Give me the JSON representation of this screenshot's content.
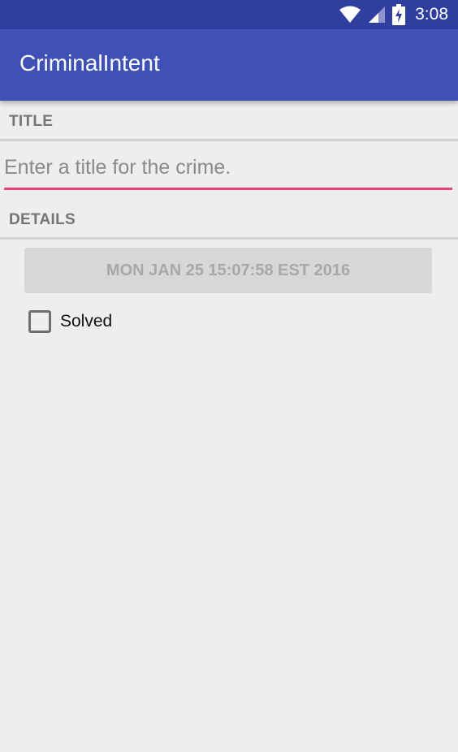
{
  "status_bar": {
    "time": "3:08",
    "icons": [
      "wifi-icon",
      "cell-signal-icon",
      "battery-charging-icon"
    ]
  },
  "app_bar": {
    "title": "CriminalIntent",
    "color": "#3f51b5",
    "status_color": "#303f9f"
  },
  "title_section": {
    "header": "TITLE",
    "input_placeholder": "Enter a title for the crime.",
    "input_value": "",
    "accent_color": "#ec407a"
  },
  "details_section": {
    "header": "DETAILS",
    "date_button_label": "MON JAN 25 15:07:58 EST 2016",
    "solved_label": "Solved",
    "solved_checked": false
  }
}
